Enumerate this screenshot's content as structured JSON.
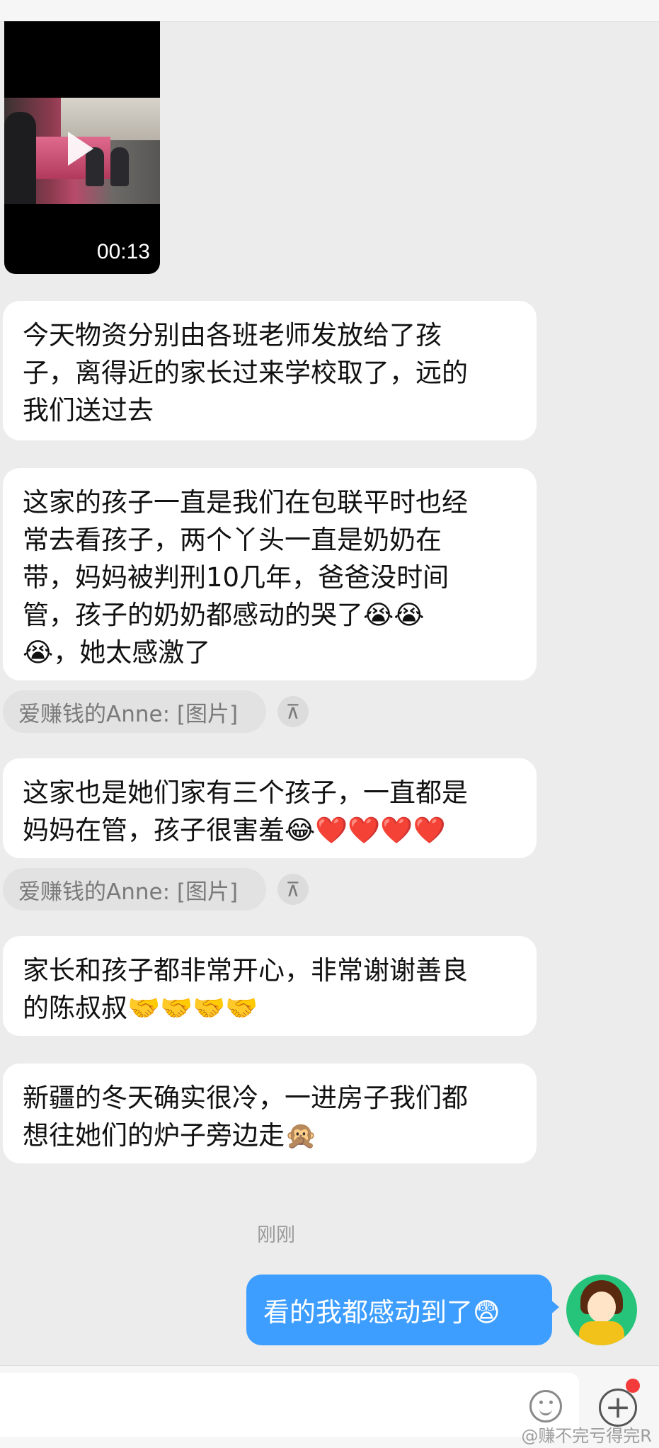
{
  "video": {
    "duration": "00:13"
  },
  "messages": [
    {
      "text": "今天物资分别由各班老师发放给了孩子，离得近的家长过来学校取了，远的我们送过去",
      "lines": [
        "今天物资分别由各班老师发放给了孩",
        "子，离得近的家长过来学校取了，远的",
        "我们送过去"
      ]
    },
    {
      "lines": [
        "这家的孩子一直是我们在包联平时也经",
        "常去看孩子，两个丫头一直是奶奶在",
        "带，妈妈被判刑10几年，爸爸没时间",
        "管，孩子的奶奶都感动的哭了😭😭",
        "😭，她太感激了"
      ]
    },
    {
      "lines": [
        "这家也是她们家有三个孩子，一直都是",
        "妈妈在管，孩子很害羞😂❤️❤️❤️❤️"
      ]
    },
    {
      "lines": [
        "家长和孩子都非常开心，非常谢谢善良",
        "的陈叔叔🤝🤝🤝🤝"
      ]
    },
    {
      "lines": [
        "新疆的冬天确实很冷，一进房子我们都",
        "想往她们的炉子旁边走🙊"
      ]
    }
  ],
  "quotes": [
    {
      "text": "爱赚钱的Anne: [图片]",
      "up_icon": "⊼"
    },
    {
      "text": "爱赚钱的Anne: [图片]",
      "up_icon": "⊼"
    }
  ],
  "timestamp": "刚刚",
  "my_message": "看的我都感动到了😨",
  "input": {
    "emoji_icon": "smiley-icon",
    "plus_icon": "+"
  },
  "watermark": "@赚不完亏得完R",
  "colors": {
    "my_bubble": "#3d9eff",
    "background": "#ececec",
    "notify_dot": "#f43b3b"
  }
}
